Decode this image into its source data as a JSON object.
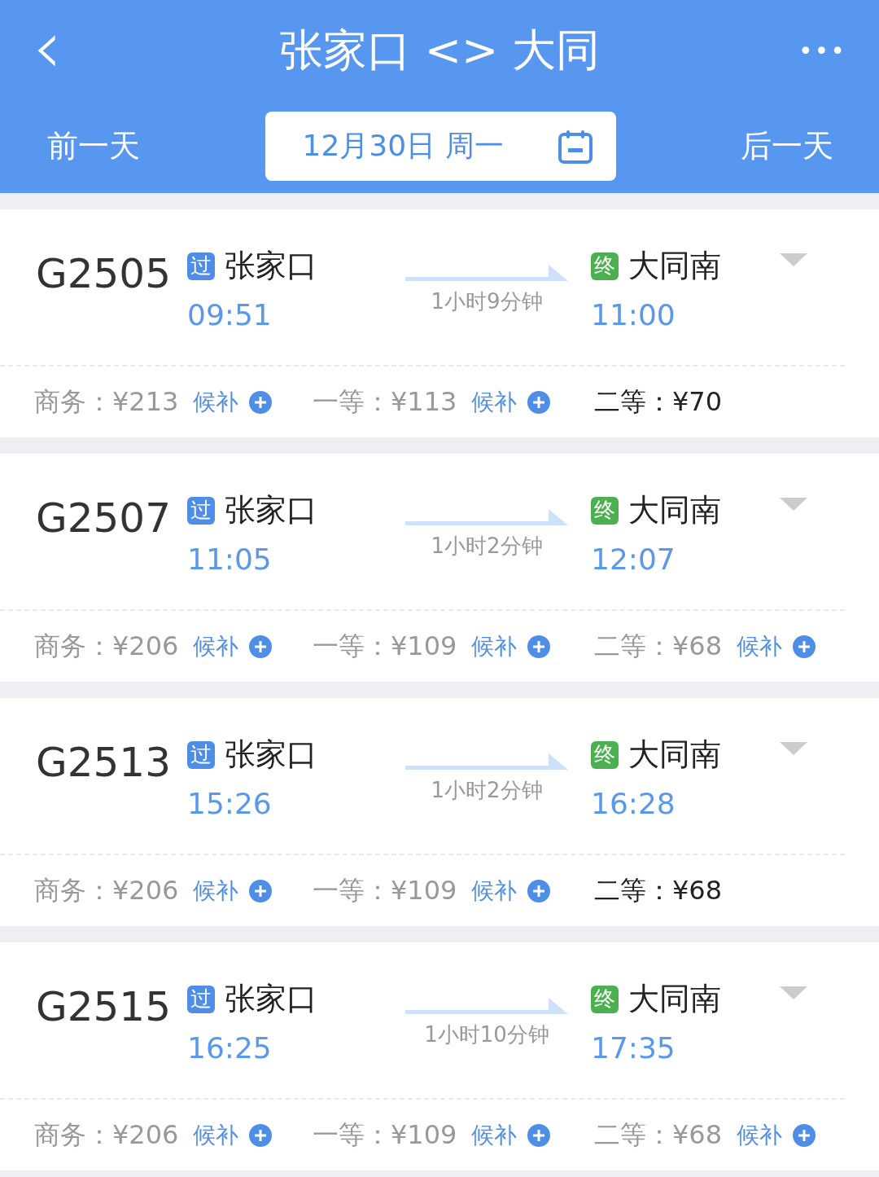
{
  "header": {
    "back": "‹",
    "title": "张家口 <> 大同",
    "more": "•••",
    "prev_day": "前一天",
    "date": "12月30日 周一",
    "next_day": "后一天"
  },
  "trains": [
    {
      "number": "G2505",
      "from": {
        "badge": "过",
        "kind": "pass",
        "name": "张家口",
        "time": "09:51"
      },
      "duration": "1小时9分钟",
      "to": {
        "badge": "终",
        "kind": "terminal",
        "name": "大同南",
        "time": "11:00"
      },
      "seats": [
        {
          "label": "商务：¥213",
          "available": false,
          "waitlist": "候补"
        },
        {
          "label": "一等：¥113",
          "available": false,
          "waitlist": "候补"
        },
        {
          "label": "二等：¥70",
          "available": true
        }
      ]
    },
    {
      "number": "G2507",
      "from": {
        "badge": "过",
        "kind": "pass",
        "name": "张家口",
        "time": "11:05"
      },
      "duration": "1小时2分钟",
      "to": {
        "badge": "终",
        "kind": "terminal",
        "name": "大同南",
        "time": "12:07"
      },
      "seats": [
        {
          "label": "商务：¥206",
          "available": false,
          "waitlist": "候补"
        },
        {
          "label": "一等：¥109",
          "available": false,
          "waitlist": "候补"
        },
        {
          "label": "二等：¥68",
          "available": false,
          "waitlist": "候补"
        }
      ]
    },
    {
      "number": "G2513",
      "from": {
        "badge": "过",
        "kind": "pass",
        "name": "张家口",
        "time": "15:26"
      },
      "duration": "1小时2分钟",
      "to": {
        "badge": "终",
        "kind": "terminal",
        "name": "大同南",
        "time": "16:28"
      },
      "seats": [
        {
          "label": "商务：¥206",
          "available": false,
          "waitlist": "候补"
        },
        {
          "label": "一等：¥109",
          "available": false,
          "waitlist": "候补"
        },
        {
          "label": "二等：¥68",
          "available": true
        }
      ]
    },
    {
      "number": "G2515",
      "from": {
        "badge": "过",
        "kind": "pass",
        "name": "张家口",
        "time": "16:25"
      },
      "duration": "1小时10分钟",
      "to": {
        "badge": "终",
        "kind": "terminal",
        "name": "大同南",
        "time": "17:35"
      },
      "seats": [
        {
          "label": "商务：¥206",
          "available": false,
          "waitlist": "候补"
        },
        {
          "label": "一等：¥109",
          "available": false,
          "waitlist": "候补"
        },
        {
          "label": "二等：¥68",
          "available": false,
          "waitlist": "候补"
        }
      ]
    }
  ]
}
